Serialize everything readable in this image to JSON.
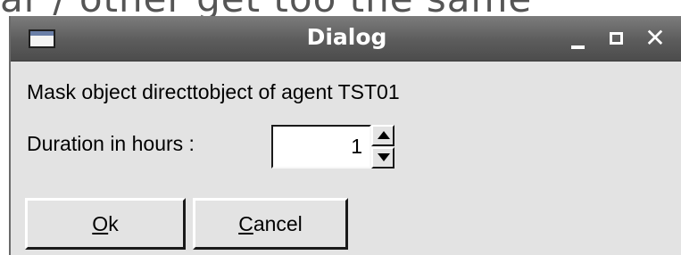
{
  "background": {
    "text": "ar / other get too the same"
  },
  "window": {
    "title": "Dialog",
    "controls": {
      "minimize_icon": "minimize-icon",
      "maximize_icon": "maximize-icon",
      "close_icon": "close-icon",
      "close_glyph": "✕"
    }
  },
  "dialog": {
    "message": "Mask object directtobject of agent TST01",
    "duration_label": "Duration in hours :",
    "duration_value": "1"
  },
  "buttons": {
    "ok_first": "O",
    "ok_rest": "k",
    "cancel_first": "C",
    "cancel_rest": "ancel"
  },
  "colors": {
    "titlebar": "#5c5c5c",
    "dialog_bg": "#e3e3e3",
    "title_text": "#ffffff"
  }
}
